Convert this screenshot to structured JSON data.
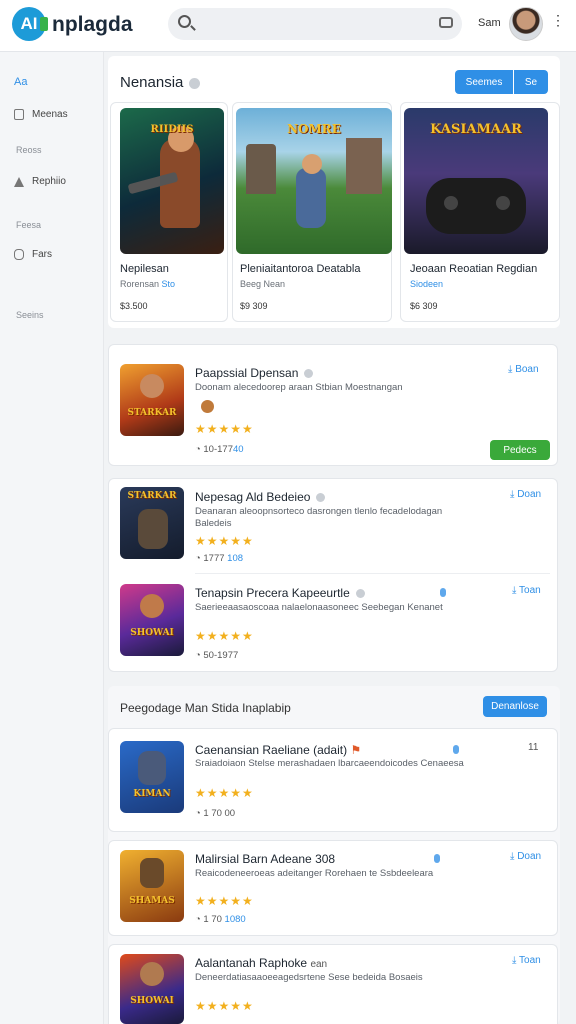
{
  "header": {
    "logo_glyph": "AI",
    "brand": "nplagda",
    "search_placeholder": "",
    "user_name": "Sam",
    "more": "⋮"
  },
  "sidebar": {
    "items": [
      {
        "label": "Aa",
        "icon": "logo-icon"
      },
      {
        "label": "Meenas",
        "icon": "square-icon"
      },
      {
        "label": "Reoss",
        "icon": "none"
      },
      {
        "label": "Rephiio",
        "icon": "triangle-icon"
      },
      {
        "label": "Feesa",
        "icon": "none"
      },
      {
        "label": "Fars",
        "icon": "rounded-square-icon"
      },
      {
        "label": "Seeins",
        "icon": "none"
      }
    ]
  },
  "featured": {
    "title": "Nenansia",
    "btn_primary": "Seemes",
    "btn_secondary": "Se",
    "games": [
      {
        "art_text": "RIIDIIS",
        "name": "Nepilesan",
        "sub": "Rorensan",
        "sub_link": "Sto",
        "price": "$3.500"
      },
      {
        "art_text": "NOMRE",
        "name": "Pleniaitantoroa Deatabla",
        "sub": "Beeg Nean",
        "sub_link": "",
        "price": "$9 309"
      },
      {
        "art_text": "KASIAMAAR",
        "name": "Jeoaan Reoatian Regdian",
        "sub": "",
        "sub_link": "Siodeen",
        "price": "$6 309"
      }
    ]
  },
  "list1": [
    {
      "title": "Paapssial Dpensan",
      "desc": "Doonam alecedoorep araan Stbian Moestnangan",
      "art_text": "STARKAR",
      "stars": "★★★★★",
      "meta": "10-177",
      "meta_link": "40",
      "action": "Boan",
      "button": "Pedecs"
    }
  ],
  "list2": [
    {
      "title": "Nepesag Ald Bedeieo",
      "desc": "Deanaran aleoopnsorteco dasrongen tlenlo fecadelodagan Baledeis",
      "art_text": "STARKAR",
      "stars": "★★★★★",
      "meta": "1777",
      "meta_link": "108",
      "action": "Doan"
    },
    {
      "title": "Tenapsin Precera Kapeeurtle",
      "desc": "Saerieeaasaoscoaa nalaelonaasoneec Seebegan Kenanet",
      "art_text": "SHOWAI",
      "stars": "★★★★★",
      "meta": "50-1977",
      "meta_link": "",
      "action": "Toan"
    }
  ],
  "section2": {
    "title": "Peegodage Man Stida Inaplabip",
    "button": "Denanlose"
  },
  "list3": [
    {
      "title": "Caenansian Raeliane (adait)",
      "desc": "Sraiadoiaon Stelse merashadaen lbarcaeendoicodes Cenaeesa",
      "art_text": "KIMAN",
      "stars": "★★★★★",
      "meta": "1 70 00",
      "meta_link": "",
      "action": "11"
    },
    {
      "title": "Malirsial Barn Adeane 308",
      "desc": "Reaicodeneeroeas adeitanger Rorehaen te Ssbdeeleara",
      "art_text": "SHAMAS",
      "stars": "★★★★★",
      "meta": "1 70",
      "meta_link": "1080",
      "action": "Doan"
    },
    {
      "title": "Aalantanah Raphoke",
      "desc": "Deneerdatiasaaoeeagedsrtene Sese bedeida Bosaeis",
      "art_text": "SHOWAI",
      "stars": "★★★★★",
      "meta": "",
      "meta_link": "",
      "action": "Toan",
      "extra": "ean"
    }
  ],
  "colors": {
    "accent": "#2f8fe6",
    "success": "#3aa93a",
    "star": "#f2b01e"
  }
}
